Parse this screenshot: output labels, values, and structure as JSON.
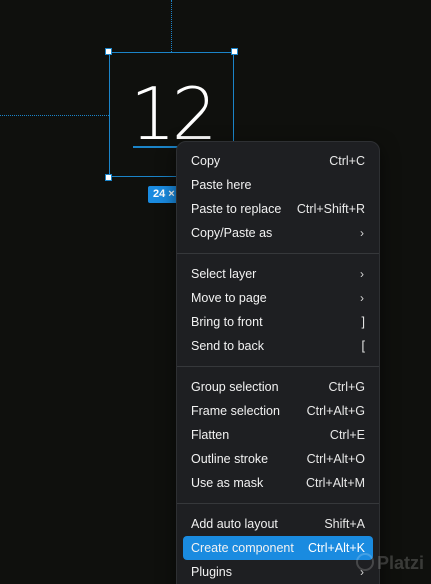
{
  "canvas": {
    "frame_text": "12",
    "size_badge": "24 ×"
  },
  "context_menu": {
    "groups": [
      [
        {
          "label": "Copy",
          "shortcut": "Ctrl+C"
        },
        {
          "label": "Paste here",
          "shortcut": ""
        },
        {
          "label": "Paste to replace",
          "shortcut": "Ctrl+Shift+R"
        },
        {
          "label": "Copy/Paste as",
          "shortcut": "",
          "submenu": true
        }
      ],
      [
        {
          "label": "Select layer",
          "shortcut": "",
          "submenu": true
        },
        {
          "label": "Move to page",
          "shortcut": "",
          "submenu": true
        },
        {
          "label": "Bring to front",
          "shortcut": "]"
        },
        {
          "label": "Send to back",
          "shortcut": "["
        }
      ],
      [
        {
          "label": "Group selection",
          "shortcut": "Ctrl+G"
        },
        {
          "label": "Frame selection",
          "shortcut": "Ctrl+Alt+G"
        },
        {
          "label": "Flatten",
          "shortcut": "Ctrl+E"
        },
        {
          "label": "Outline stroke",
          "shortcut": "Ctrl+Alt+O"
        },
        {
          "label": "Use as mask",
          "shortcut": "Ctrl+Alt+M"
        }
      ],
      [
        {
          "label": "Add auto layout",
          "shortcut": "Shift+A"
        },
        {
          "label": "Create component",
          "shortcut": "Ctrl+Alt+K",
          "highlighted": true
        },
        {
          "label": "Plugins",
          "shortcut": "",
          "submenu": true
        }
      ]
    ]
  },
  "watermark": "Platzi",
  "colors": {
    "background": "#0f100d",
    "selection": "#1b84c8",
    "highlight": "#1a8be0",
    "menu_bg": "#1e1f22"
  }
}
